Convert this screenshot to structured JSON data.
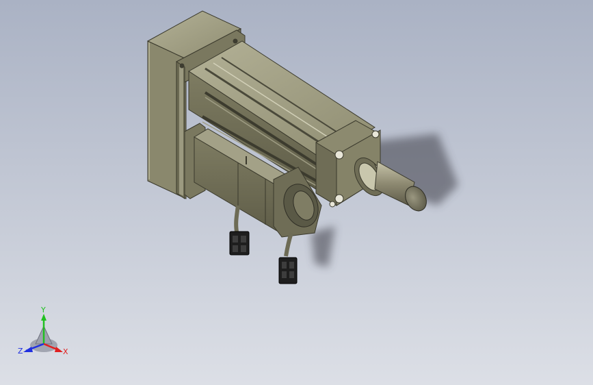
{
  "viewport": {
    "background_top": "#aab2c4",
    "background_bottom": "#dcdfe6"
  },
  "model": {
    "body_color": "#868467",
    "shadow_color": "#55534a",
    "highlight_color": "#c4c2a8",
    "shaft_color": "#8e8a72",
    "connector_color": "#1e1e1e"
  },
  "triad": {
    "x_label": "X",
    "y_label": "Y",
    "z_label": "Z",
    "x_color": "#e02020",
    "y_color": "#20c020",
    "z_color": "#2030e0"
  }
}
